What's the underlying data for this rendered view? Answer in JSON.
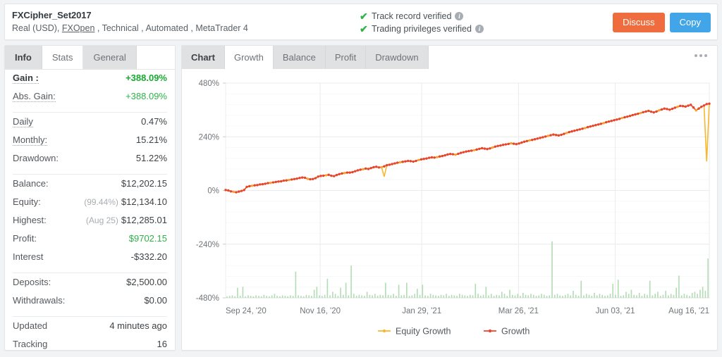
{
  "header": {
    "account_name": "FXCipher_Set2017",
    "subtitle_prefix": "Real (USD), ",
    "broker_link": "FXOpen",
    "subtitle_suffix": " , Technical , Automated , MetaTrader 4",
    "verified": [
      {
        "label": "Track record verified",
        "info": "i"
      },
      {
        "label": "Trading privileges verified",
        "info": "i"
      }
    ],
    "check_glyph": "✔",
    "buttons": {
      "discuss": "Discuss",
      "copy": "Copy",
      "discuss_color": "#ef6c3e",
      "copy_color": "#42a5e8"
    }
  },
  "left_panel": {
    "tabs": [
      {
        "label": "Info",
        "active": false
      },
      {
        "label": "Stats",
        "active": true
      },
      {
        "label": "General",
        "active": false
      }
    ],
    "groups": [
      {
        "rows": [
          {
            "label": "Gain :",
            "value": "+388.09%",
            "style": "greenbold",
            "label_style": "bold dotted"
          },
          {
            "label": "Abs. Gain:",
            "value": "+388.09%",
            "style": "green",
            "label_style": "dotted"
          }
        ]
      },
      {
        "rows": [
          {
            "label": "Daily",
            "value": "0.47%",
            "style": "",
            "label_style": "dotted"
          },
          {
            "label": "Monthly:",
            "value": "15.21%",
            "style": "",
            "label_style": "dotted"
          },
          {
            "label": "Drawdown:",
            "value": "51.22%",
            "style": "",
            "label_style": ""
          }
        ]
      },
      {
        "rows": [
          {
            "label": "Balance:",
            "value": "$12,202.15",
            "style": "",
            "label_style": ""
          },
          {
            "label": "Equity:",
            "prefix": "(99.44%)",
            "value": "$12,134.10",
            "style": "",
            "label_style": ""
          },
          {
            "label": "Highest:",
            "prefix": "(Aug 25)",
            "value": "$12,285.01",
            "style": "",
            "label_style": ""
          },
          {
            "label": "Profit:",
            "value": "$9702.15",
            "style": "green",
            "label_style": ""
          },
          {
            "label": "Interest",
            "value": "-$332.20",
            "style": "",
            "label_style": ""
          }
        ]
      },
      {
        "rows": [
          {
            "label": "Deposits:",
            "value": "$2,500.00",
            "style": "",
            "label_style": ""
          },
          {
            "label": "Withdrawals:",
            "value": "$0.00",
            "style": "",
            "label_style": ""
          }
        ]
      },
      {
        "rows": [
          {
            "label": "Updated",
            "value": "4 minutes ago",
            "style": "",
            "label_style": ""
          },
          {
            "label": "Tracking",
            "value": "16",
            "style": "",
            "label_style": ""
          }
        ]
      }
    ]
  },
  "chart_panel": {
    "section_label": "Chart",
    "tabs": [
      {
        "label": "Growth",
        "active": true
      },
      {
        "label": "Balance",
        "active": false
      },
      {
        "label": "Profit",
        "active": false
      },
      {
        "label": "Drawdown",
        "active": false
      }
    ],
    "menu_icon": "more-horizontal"
  },
  "chart_data": {
    "type": "line",
    "title": "",
    "xlabel": "",
    "ylabel": "",
    "ylim": [
      -480,
      480
    ],
    "yticks": [
      480,
      240,
      0,
      -240,
      -480
    ],
    "ytick_labels": [
      "480%",
      "240%",
      "0%",
      "-240%",
      "-480%"
    ],
    "minor_gridlines": true,
    "grid": true,
    "legend_position": "bottom",
    "xtick_labels": [
      "Sep 24, '20",
      "Nov 16, '20",
      "Jan 29, '21",
      "Mar 26, '21",
      "Jun 03, '21",
      "Aug 16, '21"
    ],
    "xtick_positions": [
      0,
      0.1955,
      0.4055,
      0.6055,
      0.8055,
      1.0
    ],
    "series": [
      {
        "name": "Growth",
        "color": "#e8462a",
        "marker_color": "#f5a623",
        "values": [
          2,
          0,
          -4,
          -6,
          -8,
          -5,
          -2,
          2,
          16,
          19,
          21,
          23,
          24,
          27,
          28,
          30,
          33,
          34,
          36,
          38,
          40,
          41,
          44,
          45,
          47,
          49,
          51,
          53,
          56,
          58,
          57,
          52,
          50,
          51,
          55,
          62,
          65,
          66,
          68,
          70,
          66,
          64,
          69,
          73,
          76,
          78,
          80,
          80,
          82,
          86,
          90,
          93,
          95,
          98,
          96,
          100,
          104,
          106,
          103,
          104,
          108,
          113,
          115,
          118,
          121,
          124,
          126,
          128,
          130,
          132,
          131,
          129,
          132,
          136,
          139,
          141,
          143,
          146,
          148,
          147,
          149,
          152,
          154,
          157,
          161,
          163,
          162,
          160,
          164,
          168,
          171,
          174,
          176,
          178,
          180,
          183,
          186,
          189,
          187,
          185,
          188,
          192,
          196,
          199,
          201,
          204,
          206,
          208,
          211,
          209,
          207,
          210,
          214,
          218,
          221,
          224,
          226,
          229,
          232,
          235,
          238,
          241,
          244,
          247,
          250,
          248,
          246,
          249,
          253,
          257,
          261,
          264,
          267,
          270,
          273,
          276,
          279,
          283,
          286,
          289,
          292,
          295,
          298,
          301,
          305,
          308,
          311,
          314,
          317,
          320,
          324,
          327,
          330,
          333,
          337,
          340,
          343,
          346,
          350,
          353,
          356,
          352,
          349,
          353,
          358,
          362,
          366,
          364,
          361,
          365,
          370,
          374,
          378,
          377,
          375,
          379,
          383,
          371,
          358,
          366,
          374,
          380,
          386,
          388
        ]
      },
      {
        "name": "Equity Growth",
        "color": "#f7b731",
        "dips": [
          {
            "index": 60,
            "value": 62
          },
          {
            "index": 182,
            "value": 130
          }
        ]
      }
    ],
    "volume_bars": {
      "name": "Volume",
      "color": "#a5d6a7",
      "baseline": -480,
      "max_value": 120,
      "values": [
        3,
        4,
        5,
        3,
        20,
        4,
        22,
        3,
        5,
        4,
        3,
        5,
        4,
        3,
        6,
        4,
        3,
        5,
        8,
        4,
        3,
        5,
        4,
        3,
        5,
        4,
        52,
        5,
        4,
        3,
        6,
        5,
        4,
        16,
        22,
        5,
        4,
        6,
        38,
        5,
        12,
        8,
        4,
        20,
        6,
        30,
        5,
        64,
        8,
        4,
        6,
        5,
        4,
        12,
        6,
        5,
        8,
        4,
        6,
        5,
        30,
        6,
        5,
        8,
        4,
        26,
        5,
        6,
        30,
        4,
        5,
        8,
        18,
        6,
        26,
        5,
        4,
        8,
        6,
        5,
        4,
        6,
        5,
        8,
        4,
        6,
        5,
        4,
        8,
        6,
        5,
        4,
        6,
        5,
        28,
        8,
        4,
        6,
        22,
        5,
        8,
        4,
        6,
        5,
        12,
        8,
        4,
        16,
        6,
        5,
        8,
        4,
        10,
        6,
        5,
        8,
        6,
        4,
        5,
        8,
        6,
        4,
        5,
        112,
        6,
        8,
        5,
        4,
        6,
        8,
        5,
        14,
        6,
        4,
        34,
        5,
        8,
        6,
        4,
        10,
        5,
        8,
        6,
        4,
        5,
        8,
        28,
        6,
        36,
        4,
        5,
        12,
        8,
        16,
        6,
        5,
        10,
        4,
        8,
        6,
        34,
        5,
        8,
        12,
        4,
        6,
        14,
        5,
        8,
        6,
        20,
        44,
        5,
        8,
        6,
        4,
        10,
        12,
        8,
        16,
        22,
        14,
        78
      ]
    }
  }
}
